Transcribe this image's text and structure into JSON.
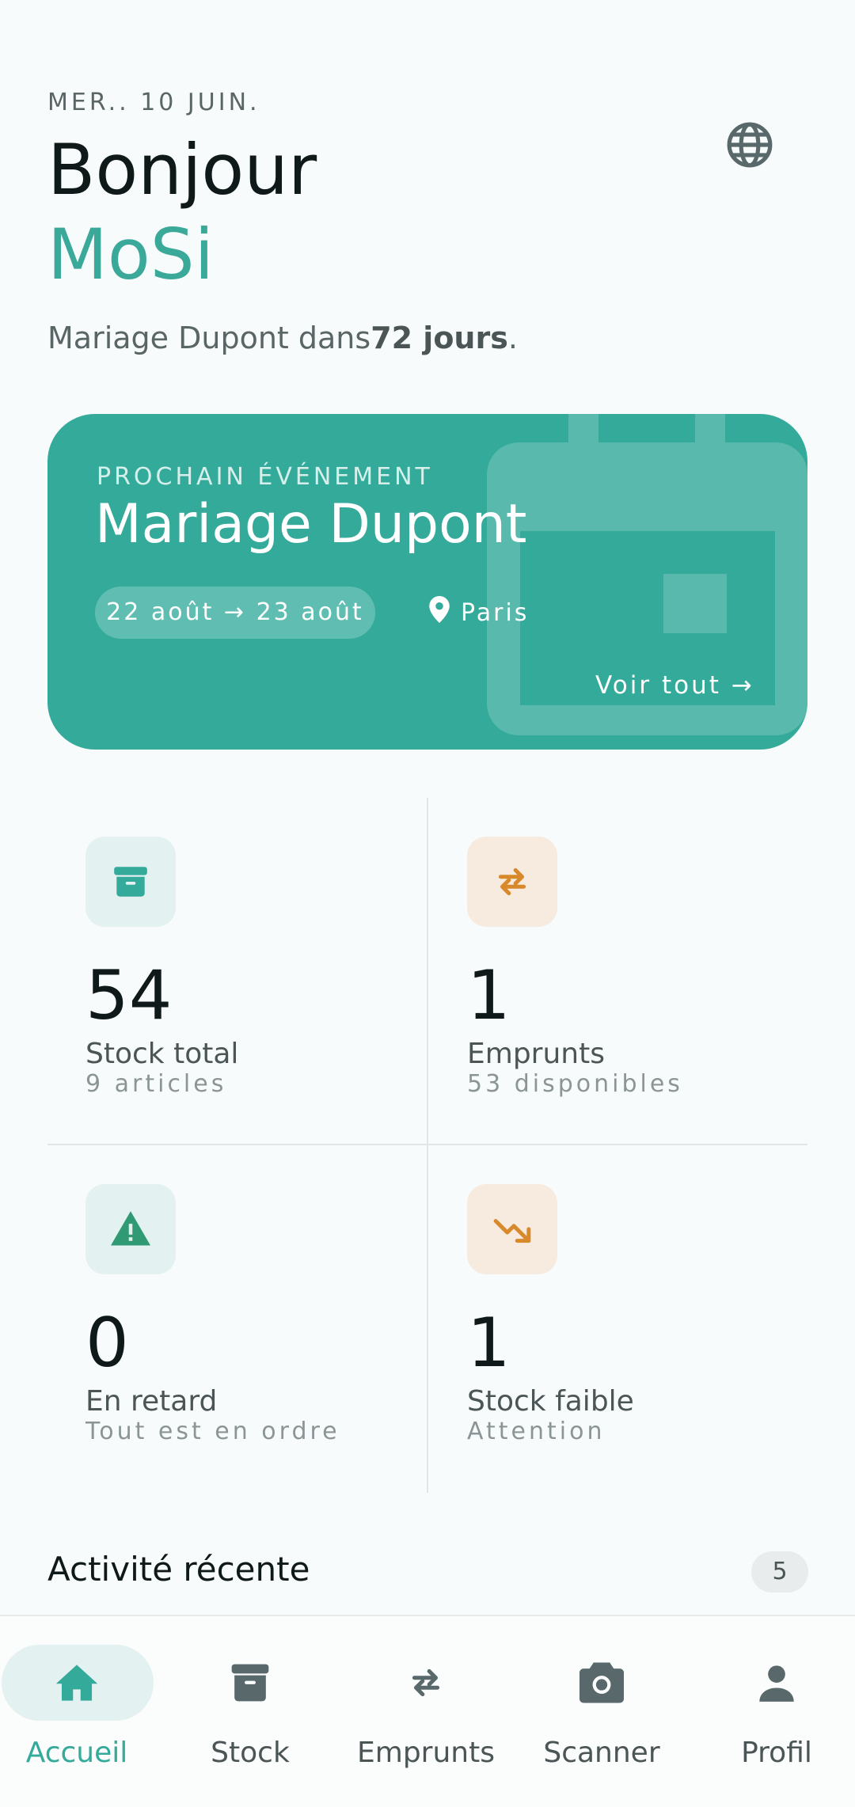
{
  "header": {
    "date": "MER.. 10 JUIN.",
    "greeting": "Bonjour",
    "user_name": "MoSi",
    "subtitle_prefix": "Mariage Dupont dans",
    "subtitle_days": "72 jours",
    "subtitle_suffix": ".",
    "language_icon": "globe-icon"
  },
  "hero": {
    "label": "PROCHAIN ÉVÉNEMENT",
    "title": "Mariage Dupont",
    "dates": "22 août → 23 août",
    "location": "Paris",
    "location_icon": "map-pin-icon",
    "see_all": "Voir tout →",
    "background_icon": "calendar-icon",
    "color": "#34aa9b"
  },
  "stats": [
    {
      "icon": "archive-box-icon",
      "value": "54",
      "label": "Stock total",
      "sub": "9 articles",
      "tint": "green"
    },
    {
      "icon": "swap-arrows-icon",
      "value": "1",
      "label": "Emprunts",
      "sub": "53 disponibles",
      "tint": "orange"
    },
    {
      "icon": "warning-triangle-icon",
      "value": "0",
      "label": "En retard",
      "sub": "Tout est en ordre",
      "tint": "green"
    },
    {
      "icon": "trending-down-icon",
      "value": "1",
      "label": "Stock faible",
      "sub": "Attention",
      "tint": "orange"
    }
  ],
  "activity": {
    "title": "Activité récente",
    "count": "5"
  },
  "nav": {
    "items": [
      {
        "label": "Accueil",
        "icon": "home-icon",
        "active": true
      },
      {
        "label": "Stock",
        "icon": "archive-box-icon",
        "active": false
      },
      {
        "label": "Emprunts",
        "icon": "swap-arrows-icon",
        "active": false
      },
      {
        "label": "Scanner",
        "icon": "camera-icon",
        "active": false
      },
      {
        "label": "Profil",
        "icon": "person-icon",
        "active": false
      }
    ]
  },
  "colors": {
    "accent": "#34aa9b",
    "orange": "#d7892c",
    "text": "#0f1919",
    "muted": "#5a6566"
  }
}
